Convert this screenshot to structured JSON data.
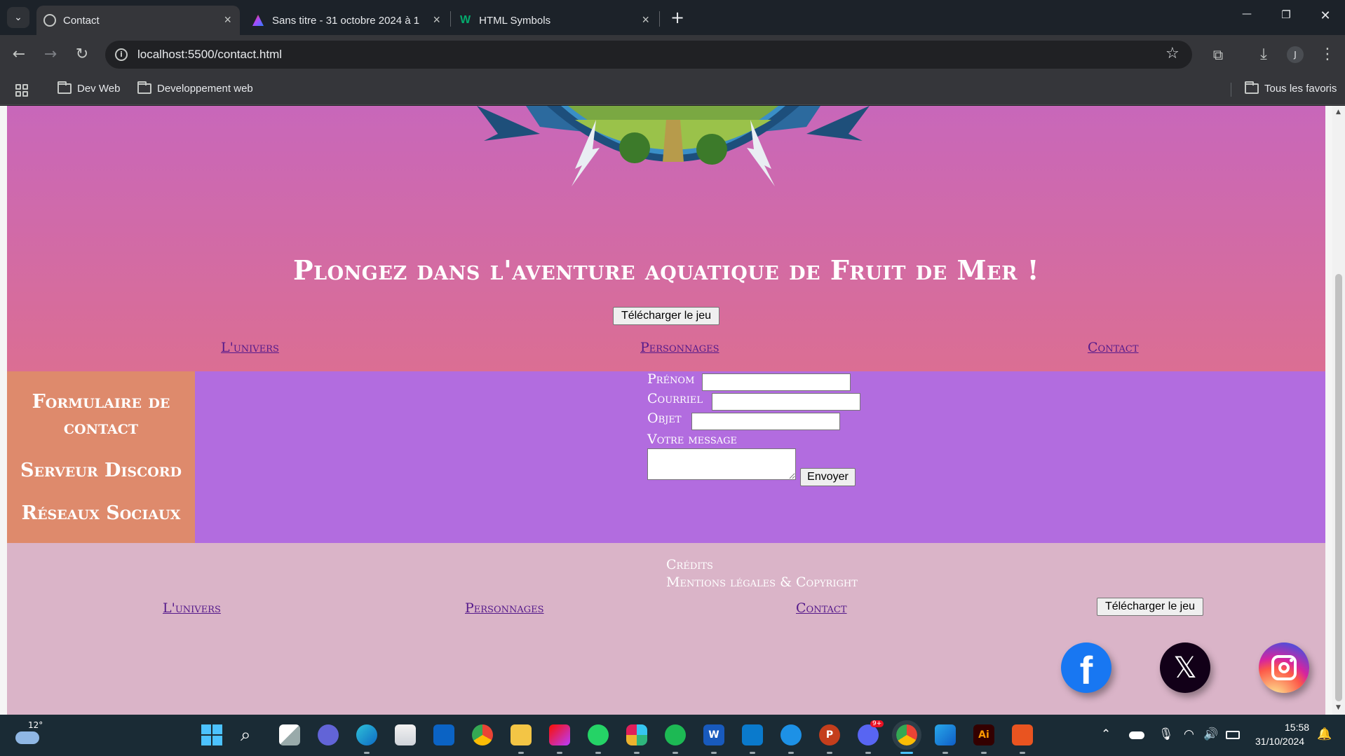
{
  "browser": {
    "tabs": [
      {
        "title": "Contact",
        "active": true
      },
      {
        "title": "Sans titre - 31 octobre 2024 à 1",
        "active": false
      },
      {
        "title": "HTML Symbols",
        "active": false
      }
    ],
    "new_tab": "+",
    "window_controls": {
      "minimize": "—",
      "restore": "❐",
      "close": "✕"
    },
    "url": "localhost:5500/contact.html",
    "bookmarks": [
      "Dev Web",
      "Developpement web"
    ],
    "all_bookmarks": "Tous les favoris",
    "profile_initial": "J"
  },
  "page": {
    "title": "Plongez dans l'aventure aquatique de Fruit de Mer !",
    "download_button": "Télécharger le jeu",
    "nav": [
      "L'univers",
      "Personnages",
      "Contact"
    ],
    "aside": {
      "item1": "Formulaire de contact",
      "item2": "Serveur Discord",
      "item3": "Réseaux Sociaux"
    },
    "form": {
      "firstname_label": "Prénom",
      "email_label": "Courriel",
      "subject_label": "Objet",
      "message_label": "Votre message",
      "submit": "Envoyer"
    },
    "footer": {
      "credits": "Crédits",
      "legal": "Mentions légales & Copyright",
      "nav": [
        "L'univers",
        "Personnages",
        "Contact"
      ],
      "download_button": "Télécharger le jeu",
      "social": [
        "facebook",
        "x",
        "instagram"
      ]
    }
  },
  "taskbar": {
    "weather_temp": "12°",
    "time": "15:58",
    "date": "31/10/2024",
    "discord_badge": "9+"
  },
  "colors": {
    "hero_top": "#c867ba",
    "hero_bottom": "#db6e93",
    "form_bg": "#b26cdf",
    "aside_bg": "#de8a6c",
    "footer_bg": "#dab4c8",
    "link": "#551a8b"
  }
}
